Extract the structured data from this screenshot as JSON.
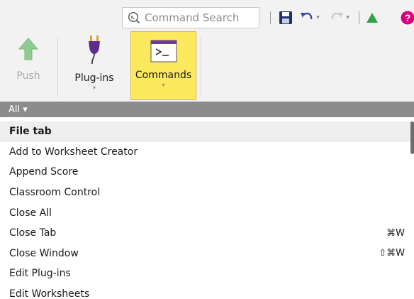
{
  "search": {
    "placeholder": "Command Search"
  },
  "ribbon": {
    "push_label": "Push",
    "plugins_label": "Plug-ins",
    "commands_label": "Commands",
    "dropdown_glyph": "▾"
  },
  "icons": {
    "search": "command-search-icon",
    "save": "save-icon",
    "undo": "undo-icon",
    "redo": "redo-icon",
    "alert": "warning-icon",
    "help": "help-icon",
    "push": "push-up-arrow-icon",
    "plugins": "plug-icon",
    "commands": "terminal-icon"
  },
  "colors": {
    "accent_active": "#fde95d",
    "filter_bar": "#8c8c8c",
    "push_arrow": "#8fcc8f",
    "help_badge": "#d6007f"
  },
  "filter": {
    "label": "All ▾"
  },
  "list": {
    "header": "File tab",
    "items": [
      {
        "label": "Add to Worksheet Creator",
        "shortcut": ""
      },
      {
        "label": "Append Score",
        "shortcut": ""
      },
      {
        "label": "Classroom Control",
        "shortcut": ""
      },
      {
        "label": "Close All",
        "shortcut": ""
      },
      {
        "label": "Close Tab",
        "shortcut": "⌘W"
      },
      {
        "label": "Close Window",
        "shortcut": "⇧⌘W"
      },
      {
        "label": "Edit Plug-ins",
        "shortcut": ""
      },
      {
        "label": "Edit Worksheets",
        "shortcut": ""
      }
    ]
  }
}
